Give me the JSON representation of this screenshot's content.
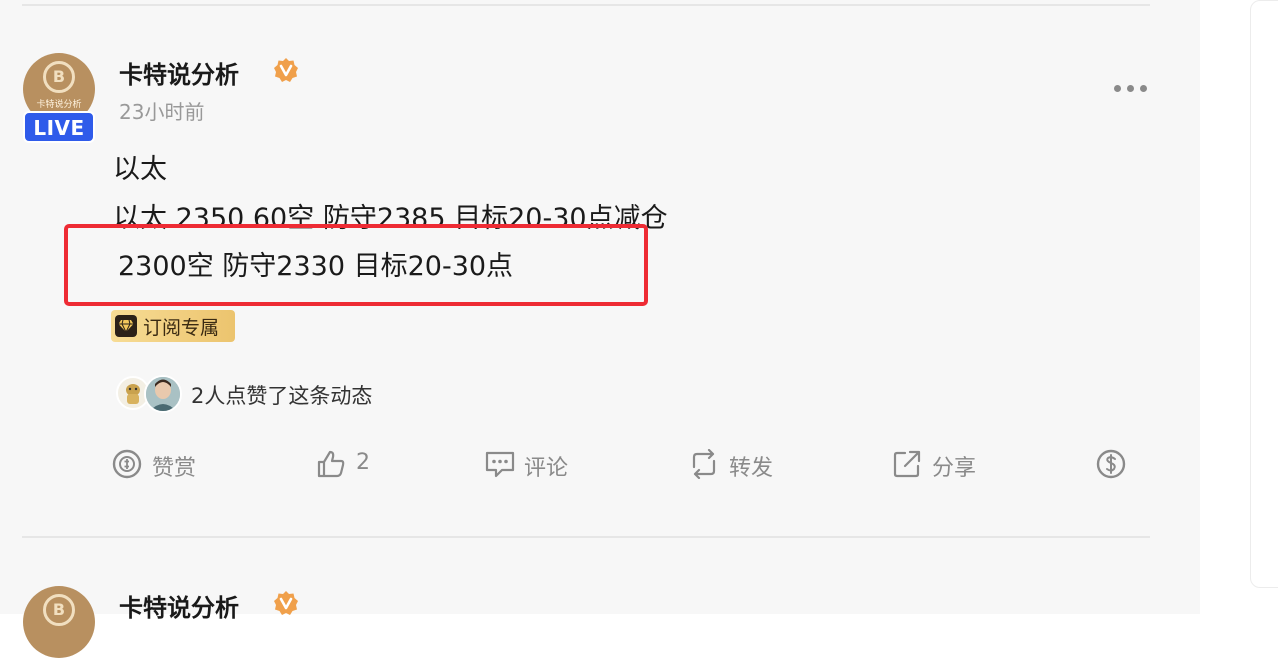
{
  "post": {
    "author": "卡特说分析",
    "avatar_text": "卡特说分析",
    "avatar_logo": "B",
    "live_badge": "LIVE",
    "time": "23小时前",
    "lines": [
      "以太",
      "以太 2350 60空 防守2385 目标20-30点减仓",
      "2300空 防守2330 目标20-30点"
    ],
    "subscription_tag": "订阅专属",
    "likes_text": "2人点赞了这条动态",
    "actions": {
      "reward": "赞赏",
      "like_count": "2",
      "comment": "评论",
      "repost": "转发",
      "share": "分享"
    }
  },
  "next_post": {
    "author": "卡特说分析"
  },
  "icons": [
    "verified-icon",
    "more-icon",
    "diamond-icon",
    "reward-icon",
    "like-icon",
    "comment-icon",
    "repost-icon",
    "share-icon",
    "tip-icon"
  ],
  "colors": {
    "live_badge": "#2f5bea",
    "highlight_border": "#ee2b34",
    "verified": "#f0a04b",
    "subscription_tag": "#ecc46e",
    "action_gray": "#8a8a8a"
  }
}
